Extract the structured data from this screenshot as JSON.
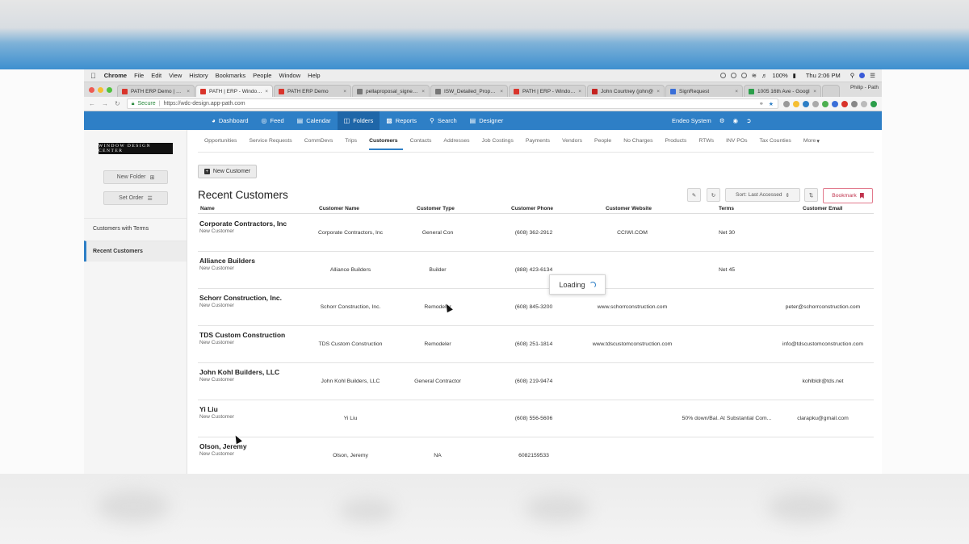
{
  "menubar": {
    "app": "Chrome",
    "items": [
      "File",
      "Edit",
      "View",
      "History",
      "Bookmarks",
      "People",
      "Window",
      "Help"
    ],
    "battery": "100%",
    "clock": "Thu 2:06 PM"
  },
  "tabs": [
    {
      "label": "PATH ERP Demo | Endeo",
      "color": "#d9342b"
    },
    {
      "label": "PATH | ERP - Window D",
      "color": "#d9342b"
    },
    {
      "label": "PATH ERP Demo",
      "color": "#d9342b"
    },
    {
      "label": "pellaproposal_signed.p",
      "color": "#777777"
    },
    {
      "label": "ISW_Detailed_Proposal",
      "color": "#777777"
    },
    {
      "label": "PATH | ERP - Window D",
      "color": "#d9342b"
    },
    {
      "label": "John Courtney (john@",
      "color": "#c5221f"
    },
    {
      "label": "SignRequest",
      "color": "#3a6fd8"
    },
    {
      "label": "1005 16th Ave - Googl",
      "color": "#2b9e4a"
    }
  ],
  "profile": "Philip - Path",
  "address": {
    "secure": "Secure",
    "url": "https://wdc-design.app-path.com"
  },
  "nav": {
    "items": [
      "Dashboard",
      "Feed",
      "Calendar",
      "Folders",
      "Reports",
      "Search",
      "Designer"
    ],
    "active": "Folders",
    "system": "Endeo System"
  },
  "sidebar": {
    "logo": "WINDOW DESIGN CENTER",
    "new_folder": "New Folder",
    "set_order": "Set Order",
    "items": [
      "Customers with Terms",
      "Recent Customers"
    ],
    "active": "Recent Customers"
  },
  "subtabs": [
    "Opportunities",
    "Service Requests",
    "CommDevs",
    "Trips",
    "Customers",
    "Contacts",
    "Addresses",
    "Job Costings",
    "Payments",
    "Vendors",
    "People",
    "No Charges",
    "Products",
    "RTWs",
    "INV POs",
    "Tax Counties",
    "More"
  ],
  "active_subtab": "Customers",
  "page": {
    "new_customer": "New Customer",
    "title": "Recent Customers",
    "sort_label": "Sort: Last Accessed",
    "bookmark": "Bookmark",
    "loading": "Loading"
  },
  "table": {
    "headers": [
      "Name",
      "Customer Name",
      "Customer Type",
      "Customer Phone",
      "Customer Website",
      "Terms",
      "Customer Email"
    ],
    "rows": [
      {
        "name": "Corporate Contractors, Inc",
        "sub": "New Customer",
        "cname": "Corporate Contractors, Inc",
        "type": "General Con",
        "phone": "(608) 362-2912",
        "web": "CCIWI.COM",
        "terms": "Net 30",
        "email": ""
      },
      {
        "name": "Alliance Builders",
        "sub": "New Customer",
        "cname": "Alliance Builders",
        "type": "Builder",
        "phone": "(888) 423-6134",
        "web": "",
        "terms": "Net 45",
        "email": ""
      },
      {
        "name": "Schorr Construction, Inc.",
        "sub": "New Customer",
        "cname": "Schorr Construction, Inc.",
        "type": "Remodeler",
        "phone": "(608) 845-3200",
        "web": "www.schorrconstruction.com",
        "terms": "",
        "email": "peter@schorrconstruction.com"
      },
      {
        "name": "TDS Custom Construction",
        "sub": "New Customer",
        "cname": "TDS Custom Construction",
        "type": "Remodeler",
        "phone": "(608) 251-1814",
        "web": "www.tdscustomconstruction.com",
        "terms": "",
        "email": "info@tdscustomconstruction.com"
      },
      {
        "name": "John Kohl Builders, LLC",
        "sub": "New Customer",
        "cname": "John Kohl Builders, LLC",
        "type": "General Contractor",
        "phone": "(608) 219-9474",
        "web": "",
        "terms": "",
        "email": "kohlbldr@tds.net"
      },
      {
        "name": "Yi Liu",
        "sub": "New Customer",
        "cname": "Yi Liu",
        "type": "",
        "phone": "(608) 556-5606",
        "web": "",
        "terms": "50% down/Bal. At Substantial Com...",
        "email": "clarapku@gmail.com"
      },
      {
        "name": "Olson, Jeremy",
        "sub": "New Customer",
        "cname": "Olson, Jeremy",
        "type": "NA",
        "phone": "6082159533",
        "web": "",
        "terms": "",
        "email": ""
      }
    ]
  }
}
